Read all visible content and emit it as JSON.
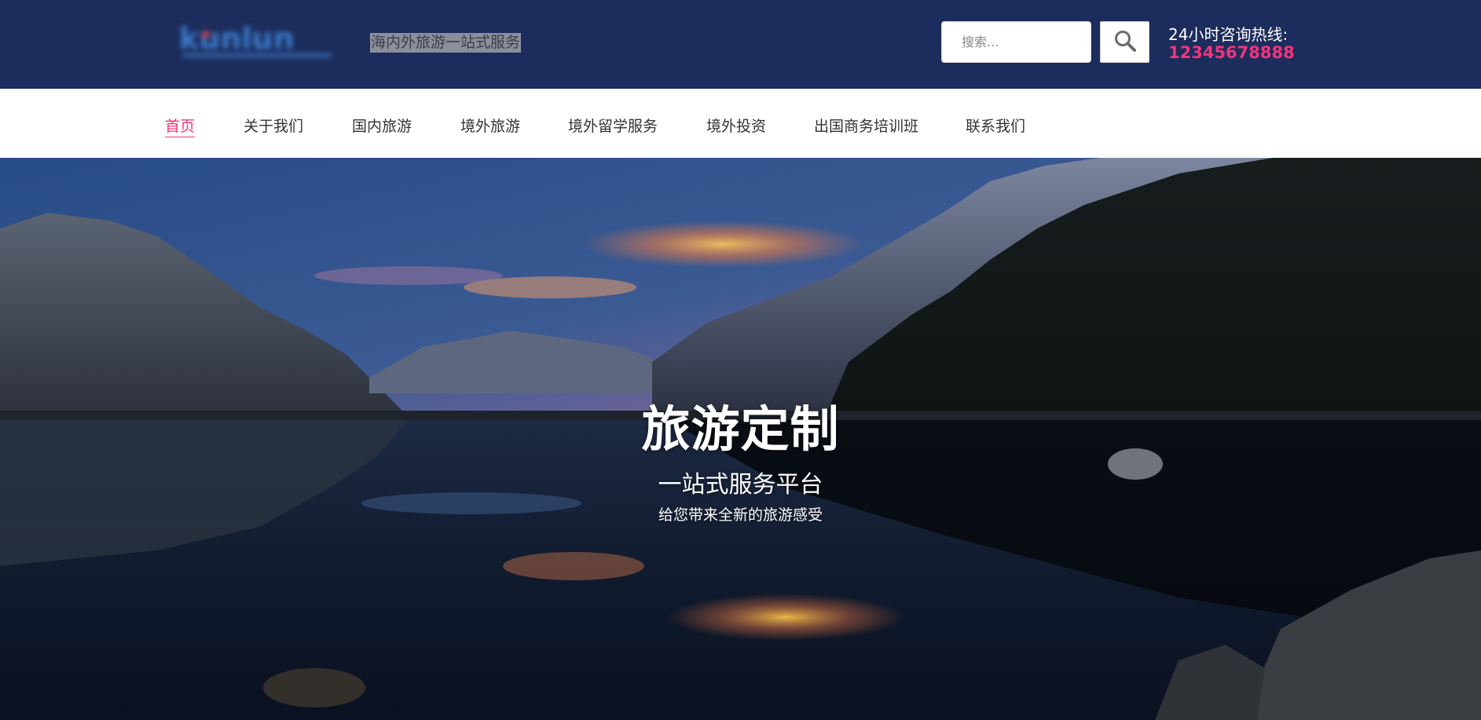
{
  "header": {
    "logo_icon": "company-logo (blurred)",
    "tagline": "海内外旅游一站式服务",
    "search": {
      "placeholder": "搜索...",
      "value": "",
      "button_icon": "search-icon"
    },
    "hotline": {
      "label": "24小时咨询热线:",
      "number": "12345678888"
    }
  },
  "nav": {
    "items": [
      {
        "label": "首页",
        "active": true
      },
      {
        "label": "关于我们",
        "active": false
      },
      {
        "label": "国内旅游",
        "active": false
      },
      {
        "label": "境外旅游",
        "active": false
      },
      {
        "label": "境外留学服务",
        "active": false
      },
      {
        "label": "境外投资",
        "active": false
      },
      {
        "label": "出国商务培训班",
        "active": false
      },
      {
        "label": "联系我们",
        "active": false
      }
    ]
  },
  "hero": {
    "title": "旅游定制",
    "subtitle": "一站式服务平台",
    "description": "给您带来全新的旅游感受",
    "image": "mountain-lake-sunset"
  },
  "colors": {
    "header_bg": "#1c2c5c",
    "accent": "#f0357a",
    "nav_text": "#333333"
  }
}
